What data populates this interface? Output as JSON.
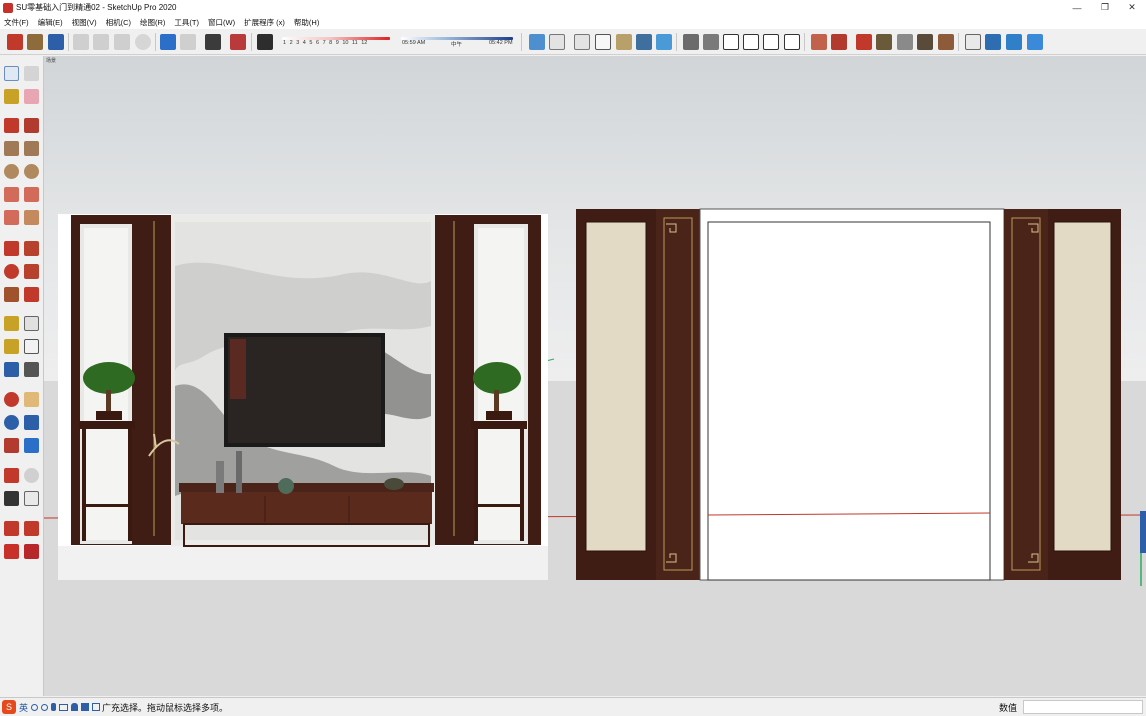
{
  "window": {
    "title": "SU零基础入门到精通02 - SketchUp Pro 2020",
    "minimize": "—",
    "restore": "❐",
    "close": "✕"
  },
  "menu": {
    "items": [
      "文件(F)",
      "编辑(E)",
      "视图(V)",
      "相机(C)",
      "绘图(R)",
      "工具(T)",
      "窗口(W)",
      "扩展程序 (x)",
      "帮助(H)"
    ]
  },
  "shadow_settings": {
    "months": [
      "1",
      "2",
      "3",
      "4",
      "5",
      "6",
      "7",
      "8",
      "9",
      "10",
      "11",
      "12"
    ],
    "time_start": "05:59 AM",
    "time_mid": "中午",
    "time_end": "05:42 PM"
  },
  "viewport": {
    "scene_tab": "场景"
  },
  "statusbar": {
    "ime_lang": "英",
    "ime_icons": [
      "punct-icon",
      "emoji-icon",
      "mic-icon",
      "keyboard-icon",
      "user-icon",
      "shirt-icon",
      "grid-icon"
    ],
    "text": "广充选择。拖动鼠标选择多项。",
    "measure_label": "数值",
    "measure_value": ""
  },
  "colors": {
    "wood_dark": "#3f1d14",
    "wood_mid": "#5a2a1c",
    "panel_cream": "#e3dac5",
    "sky": "#dfe2e3",
    "ground": "#d9d9d9",
    "axis_red": "#c0392b",
    "axis_green": "#27ae60",
    "axis_blue": "#2c5fa8"
  }
}
